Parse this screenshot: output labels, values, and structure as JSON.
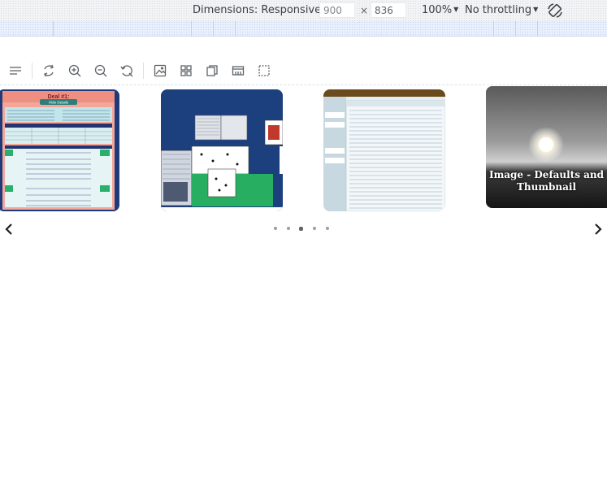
{
  "device_toolbar": {
    "dimensions_label": "Dimensions: Responsive",
    "width_value": "900",
    "times_sign": "×",
    "height_value": "836",
    "zoom_label": "100%",
    "throttling_label": "No throttling"
  },
  "viewer_toolbar": {
    "buttons": [
      "menu-icon",
      "rotate-icon",
      "zoom-in-icon",
      "zoom-out-icon",
      "reset-icon",
      "image-icon",
      "grid-icon",
      "copy-icon",
      "fit-width-icon",
      "fullscreen-icon"
    ]
  },
  "carousel": {
    "slides": [
      {
        "name": "Deal #1 bridge scoresheet",
        "title": "Deal #1:",
        "button": "Hide Details"
      },
      {
        "name": "Card game table"
      },
      {
        "name": "Spreadsheet window"
      },
      {
        "name": "Sunset image",
        "caption": "Image - Defaults and Thumbnail"
      }
    ],
    "dot_count": 5,
    "active_dot": 2
  },
  "colors": {
    "accent": "#1a73e8",
    "icon": "#5f6368",
    "toolbar_bg": "#f1f3f4"
  }
}
